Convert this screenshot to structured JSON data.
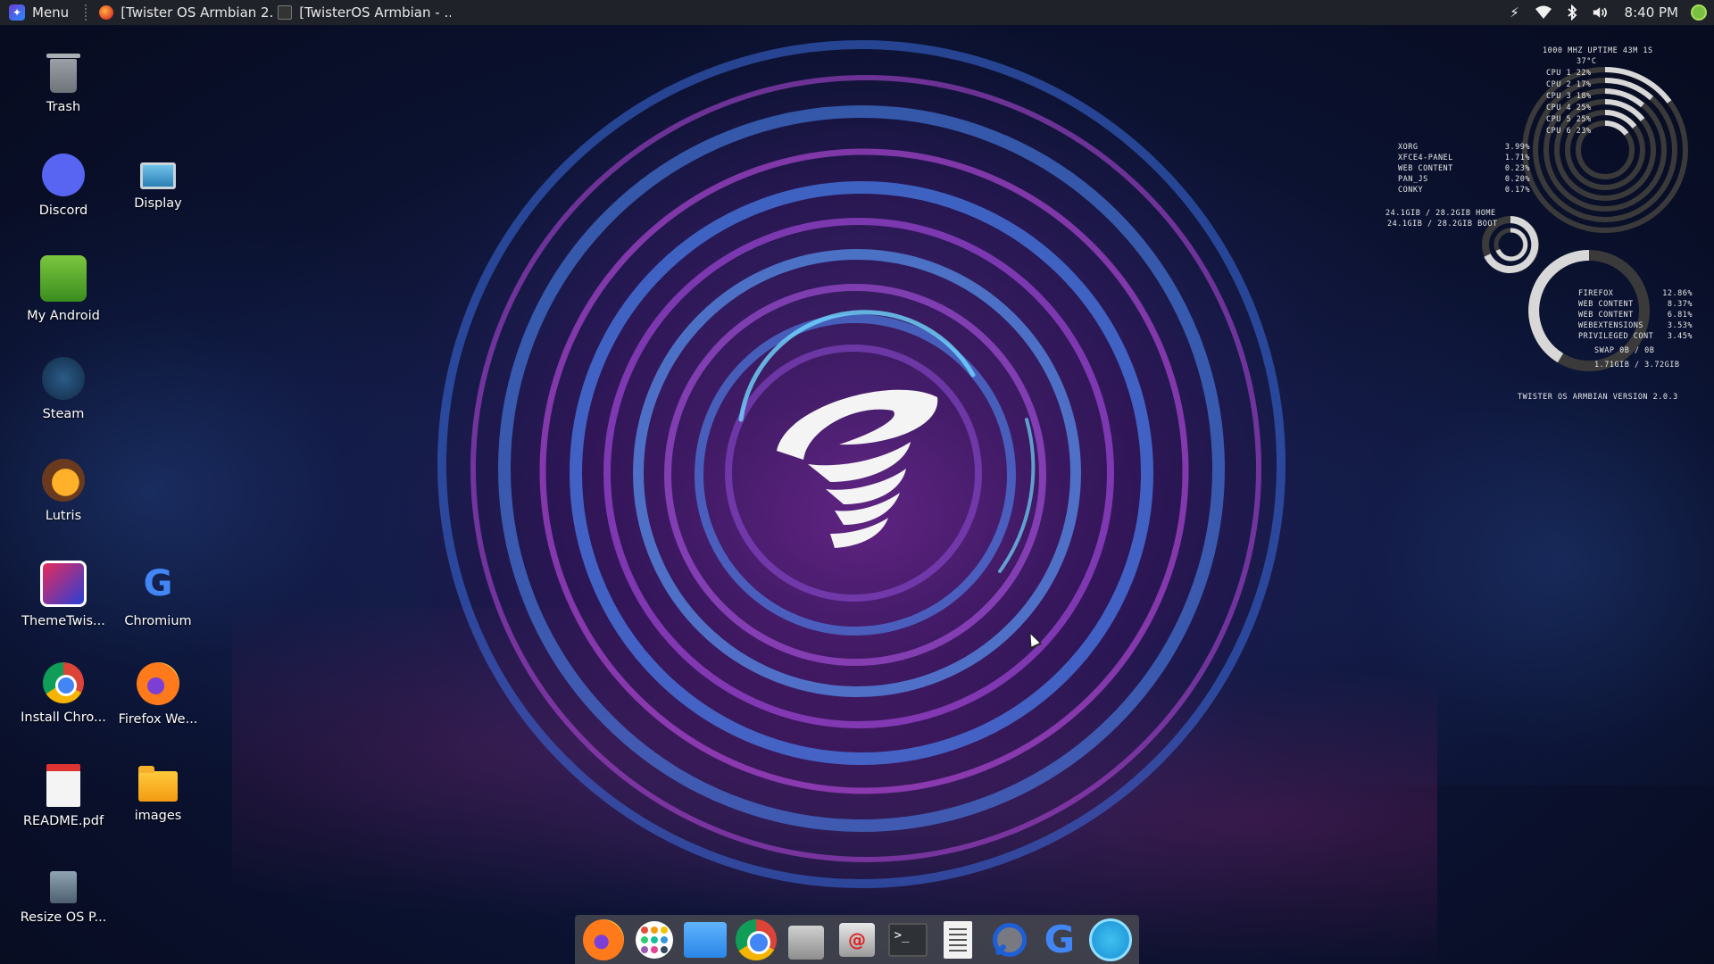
{
  "top_panel": {
    "menu_label": "Menu",
    "tasks": [
      {
        "label": "[Twister OS Armbian 2...",
        "icon": "firefox-icon"
      },
      {
        "label": "[TwisterOS Armbian - ...",
        "icon": "terminal-icon"
      }
    ],
    "clock": "8:40 PM"
  },
  "desktop_icons": [
    {
      "label": "Trash",
      "icon": "trash-icon"
    },
    {
      "label": "Discord",
      "icon": "discord-icon"
    },
    {
      "label": "Display",
      "icon": "display-icon"
    },
    {
      "label": "My Android",
      "icon": "android-icon"
    },
    {
      "label": "Steam",
      "icon": "steam-icon"
    },
    {
      "label": "Lutris",
      "icon": "lutris-icon"
    },
    {
      "label": "ThemeTwis...",
      "icon": "themetwister-icon"
    },
    {
      "label": "Chromium",
      "icon": "google-icon"
    },
    {
      "label": "Install Chro...",
      "icon": "chrome-install-icon"
    },
    {
      "label": "Firefox We...",
      "icon": "firefox-icon"
    },
    {
      "label": "README.pdf",
      "icon": "pdf-icon"
    },
    {
      "label": "images",
      "icon": "folder-icon"
    },
    {
      "label": "Resize OS P...",
      "icon": "resize-icon"
    }
  ],
  "conky": {
    "header": "1000   MHz  UPTIME 43m 1s",
    "temp": "37°C",
    "cpus": [
      "CPU 1  22%",
      "CPU 2  17%",
      "CPU 3  18%",
      "CPU 4  25%",
      "CPU 5  25%",
      "CPU 6  23%"
    ],
    "processes": [
      {
        "name": "XORG",
        "value": "3.99%"
      },
      {
        "name": "XFCE4-PANEL",
        "value": "1.71%"
      },
      {
        "name": "WEB CONTENT",
        "value": "0.23%"
      },
      {
        "name": "PAN_JS",
        "value": "0.20%"
      },
      {
        "name": "CONKY",
        "value": "0.17%"
      }
    ],
    "disks": [
      "24.1GiB / 28.2GiB HOME",
      "24.1GiB / 28.2GiB BOOT"
    ],
    "mem_processes": [
      {
        "name": "FIREFOX",
        "value": "12.86%"
      },
      {
        "name": "WEB CONTENT",
        "value": "8.37%"
      },
      {
        "name": "WEB CONTENT",
        "value": "6.81%"
      },
      {
        "name": "WEBEXTENSIONS",
        "value": "3.53%"
      },
      {
        "name": "PRIVILEGED CONT",
        "value": "3.45%"
      }
    ],
    "swap": "SWAP   0B   / 0B",
    "ram": "1.71GiB / 3.72GiB",
    "version": "TWISTER OS ARMBIAN VERSION 2.0.3"
  },
  "dock": {
    "items": [
      "firefox-icon",
      "app-grid-icon",
      "files-icon",
      "chrome-icon",
      "store-icon",
      "mail-icon",
      "terminal-icon",
      "text-editor-icon",
      "search-icon",
      "google-icon",
      "hand-app-icon"
    ],
    "terminal_glyph": ">_",
    "mail_glyph": "@",
    "google_glyph": "G"
  }
}
